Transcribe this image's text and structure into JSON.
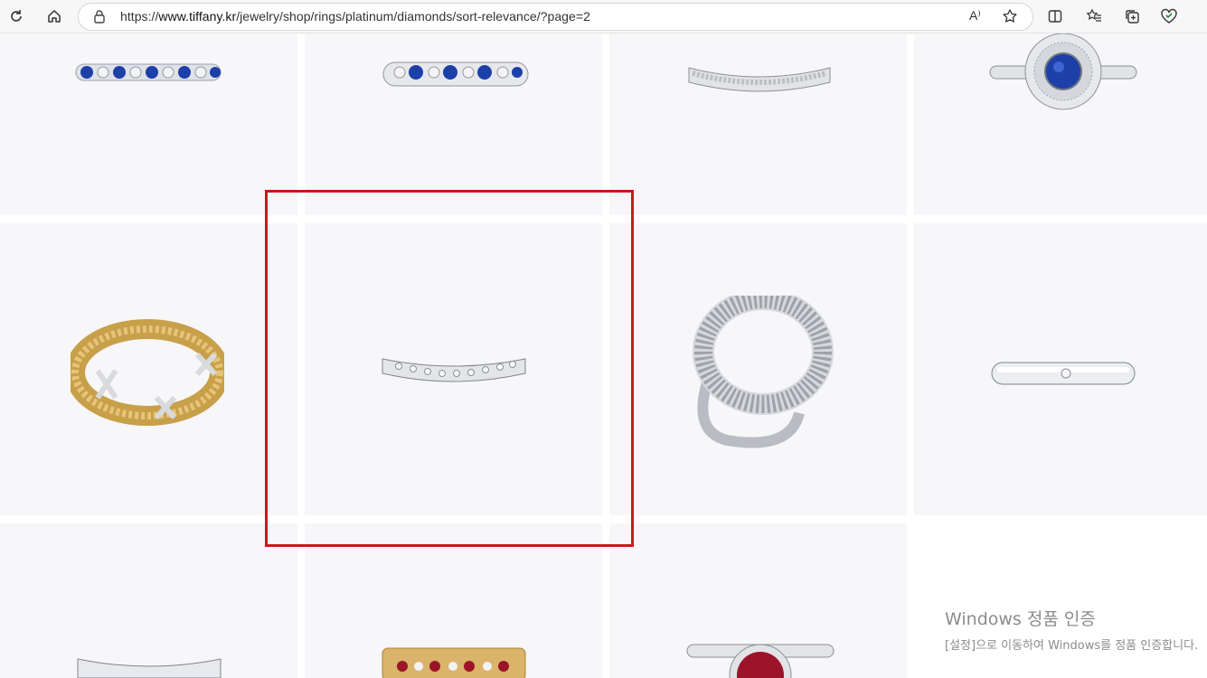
{
  "browser": {
    "url_prefix": "https://",
    "url_host": "www.tiffany.kr",
    "url_path": "/jewelry/shop/rings/platinum/diamonds/sort-relevance/?page=2",
    "read_aloud_label": "A⁾"
  },
  "products": [
    {
      "name": "sapphire-diamond-eternity-band",
      "stone_color": "#1c3fa8"
    },
    {
      "name": "sapphire-diamond-band",
      "stone_color": "#1c3fa8"
    },
    {
      "name": "curved-pave-diamond-band",
      "stone_color": "#dcdcdc"
    },
    {
      "name": "sapphire-double-halo-ring",
      "stone_color": "#1c3fa8"
    },
    {
      "name": "gold-rope-x-diamond-ring",
      "stone_color": "#d4a84a"
    },
    {
      "name": "curved-diamond-wedding-band",
      "stone_color": "#dcdcdc"
    },
    {
      "name": "open-pave-circle-ring",
      "stone_color": "#dcdcdc"
    },
    {
      "name": "solitaire-diamond-band",
      "stone_color": "#dcdcdc"
    },
    {
      "name": "curved-platinum-band",
      "stone_color": "#dcdcdc"
    },
    {
      "name": "ruby-gold-x-band",
      "stone_color": "#9c1428"
    },
    {
      "name": "ruby-engagement-ring",
      "stone_color": "#9c1428"
    }
  ],
  "highlight_color": "#c8181e",
  "windows_activation": {
    "title": "Windows 정품 인증",
    "subtitle": "[설정]으로 이동하여 Windows를 정품 인증합니다."
  }
}
